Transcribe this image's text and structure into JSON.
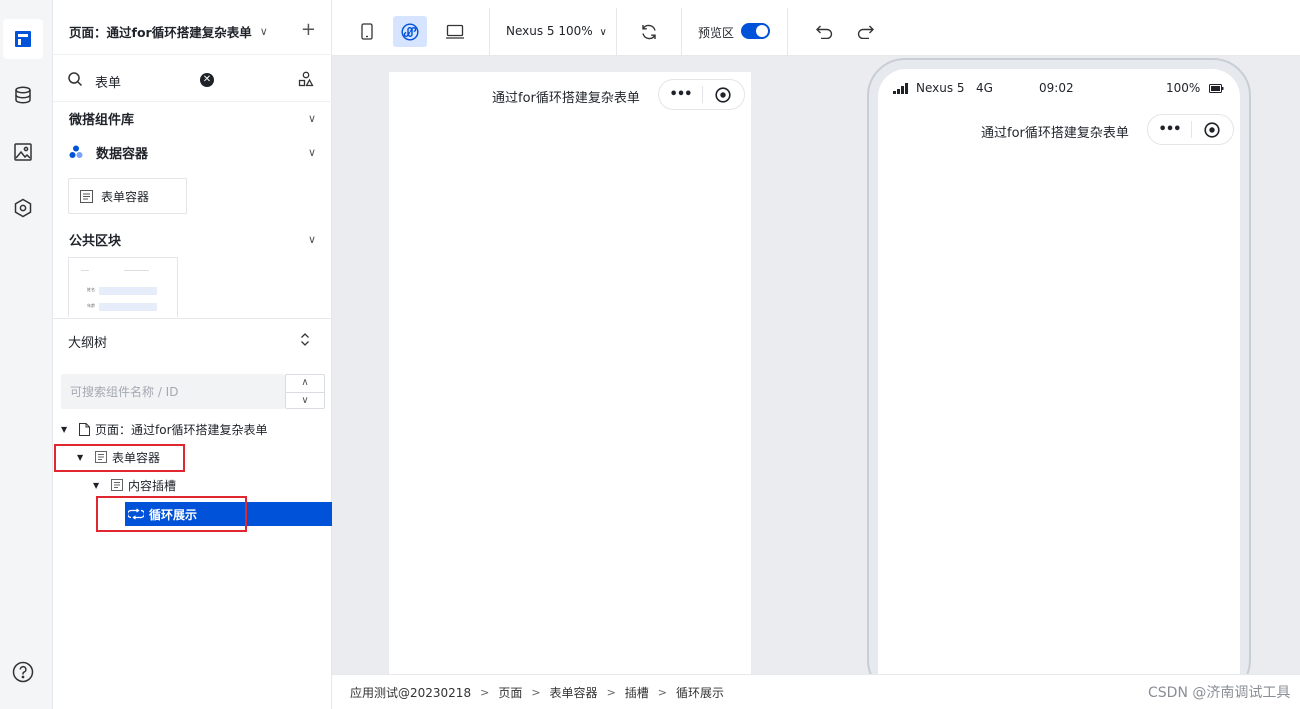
{
  "page_header": {
    "title": "页面：通过for循环搭建复杂表单"
  },
  "component_search": {
    "value": "表单"
  },
  "library": {
    "title": "微搭组件库",
    "group": "数据容器",
    "component": "表单容器"
  },
  "public_blocks": {
    "title": "公共区块",
    "thumb_rows": [
      "姓名",
      "年龄"
    ]
  },
  "outline": {
    "title": "大纲树",
    "search_placeholder": "可搜索组件名称 / ID",
    "nodes": [
      "页面：通过for循环搭建复杂表单",
      "表单容器",
      "内容插槽",
      "循环展示"
    ]
  },
  "toolbar": {
    "device": "Nexus 5 100%",
    "preview_label": "预览区",
    "preview_on": true
  },
  "preview": {
    "nav_title": "通过for循环搭建复杂表单",
    "status": {
      "carrier": "Nexus 5",
      "network": "4G",
      "time": "09:02",
      "battery": "100%"
    }
  },
  "breadcrumb": [
    "应用测试@20230218",
    "页面",
    "表单容器",
    "插槽",
    "循环展示"
  ],
  "watermark": "CSDN @济南调试工具"
}
